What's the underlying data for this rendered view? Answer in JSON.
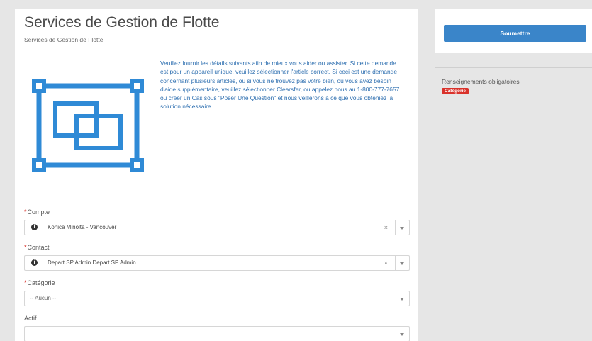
{
  "header": {
    "title": "Services de Gestion de Flotte",
    "subtitle": "Services de Gestion de Flotte"
  },
  "intro": {
    "text": "Veuillez fournir les détails suivants afin de mieux vous aider ou assister.   Si cette demande est pour un appareil unique, veuillez sélectionner l'article correct.   Si ceci est une demande concernant plusieurs articles, ou si vous ne trouvez pas votre bien, ou vous avez besoin d'aide supplémentaire, veuillez sélectionner Clearsfer, ou appelez nous au 1-800-777-7657 ou créer un Cas sous \"Poser Une Question\" et nous veillerons à ce que vous obteniez la solution nécessaire."
  },
  "logo_icon": "fleet-frame-icon",
  "form": {
    "compte": {
      "label": "Compte",
      "value": "Konica Minolta - Vancouver",
      "clear": "×"
    },
    "contact": {
      "label": "Contact",
      "value": "Depart SP Admin Depart SP Admin",
      "clear": "×"
    },
    "categorie": {
      "label": "Catégorie",
      "value": "-- Aucun --"
    },
    "actif": {
      "label": "Actif",
      "value": ""
    },
    "required_mark": "*"
  },
  "sidebar": {
    "submit_label": "Soumettre",
    "required_title": "Renseignements obligatoires",
    "badge": "Catégorie"
  },
  "colors": {
    "accent": "#3a85c9",
    "link_text": "#2e6fb0",
    "required": "#d9322b",
    "background": "#e6e6e6"
  }
}
